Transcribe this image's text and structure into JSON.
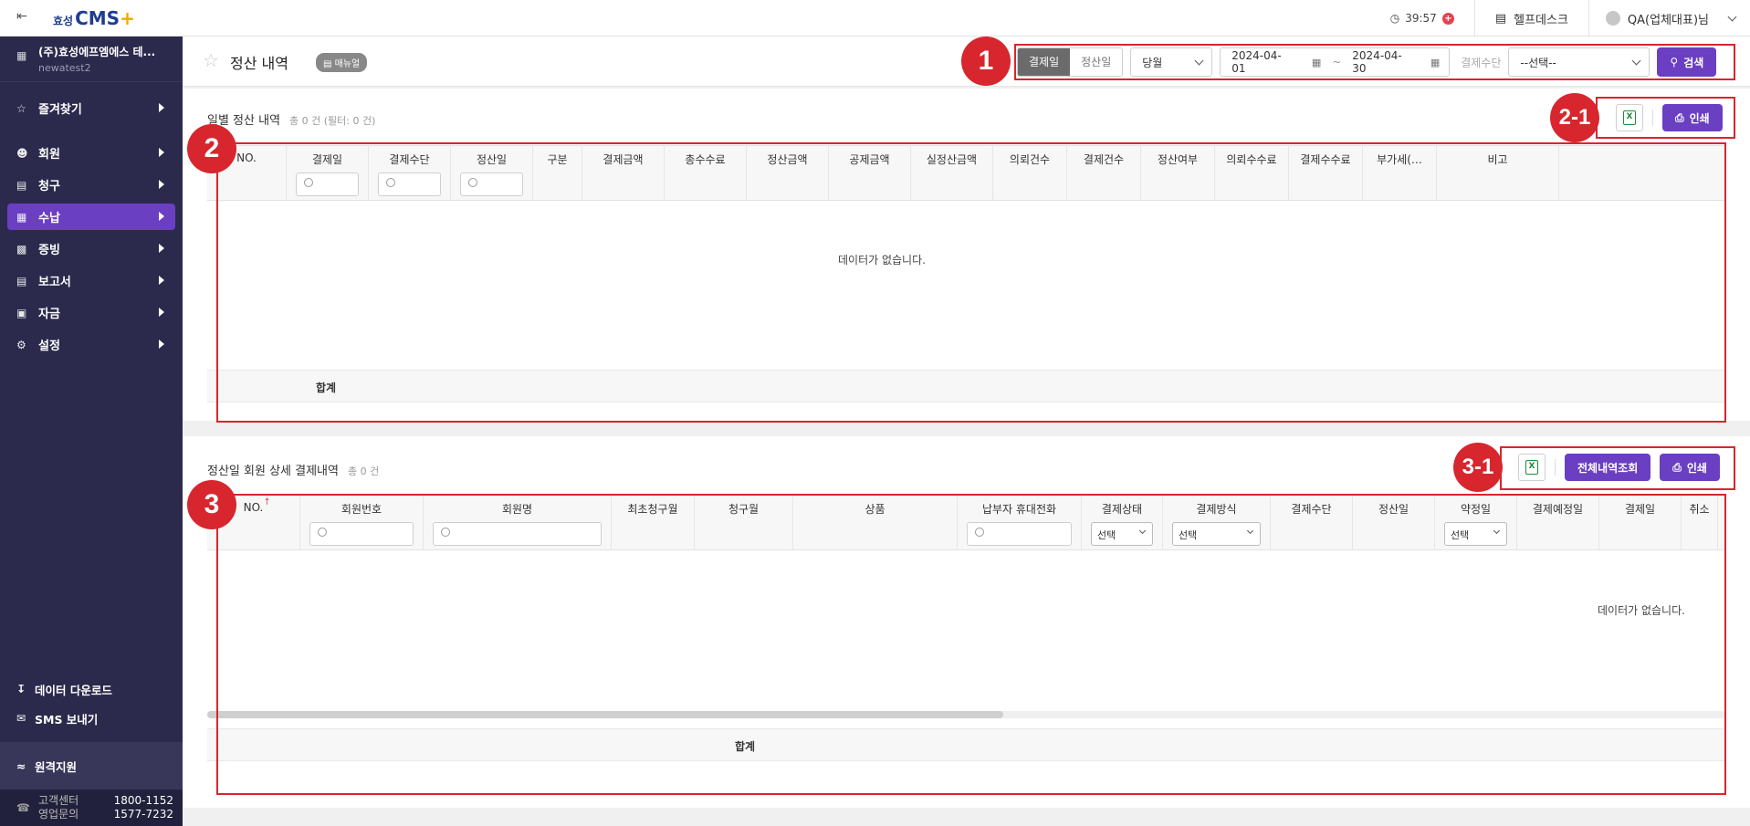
{
  "topbar": {
    "logo_prefix": "효성",
    "logo_main": "CMS",
    "logo_plus": "+",
    "timer": "39:57",
    "help": "헬프데스크",
    "user": "QA(업체대표)님"
  },
  "sidebar": {
    "company_name": "(주)효성에프엠에스 테...",
    "company_id": "newatest2",
    "items": [
      {
        "label": "즐겨찾기"
      },
      {
        "label": "회원"
      },
      {
        "label": "청구"
      },
      {
        "label": "수납"
      },
      {
        "label": "증빙"
      },
      {
        "label": "보고서"
      },
      {
        "label": "자금"
      },
      {
        "label": "설정"
      }
    ],
    "active_index": 3,
    "utilities": [
      {
        "label": "데이터 다운로드"
      },
      {
        "label": "SMS 보내기"
      }
    ],
    "remote": "원격지원",
    "contact_labels": [
      "고객센터",
      "영업문의"
    ],
    "contact_numbers": [
      "1800-1152",
      "1577-7232"
    ]
  },
  "page": {
    "title": "정산 내역",
    "manual_badge": "매뉴얼"
  },
  "filters": {
    "date_type_options": [
      "결제일",
      "정산일"
    ],
    "date_type_selected": "결제일",
    "period": "당월",
    "date_from": "2024-04-01",
    "date_separator": "~",
    "date_to": "2024-04-30",
    "method_label": "결제수단",
    "method_value": "--선택--",
    "search_label": "검색"
  },
  "section1": {
    "title": "일별 정산 내역",
    "count": "총 0 건 (필터: 0 건)",
    "print_label": "인쇄",
    "columns": [
      "NO.",
      "결제일",
      "결제수단",
      "정산일",
      "구분",
      "결제금액",
      "총수수료",
      "정산금액",
      "공제금액",
      "실정산금액",
      "의뢰건수",
      "결제건수",
      "정산여부",
      "의뢰수수료",
      "결제수수료",
      "부가세(…",
      "비고"
    ],
    "empty": "데이터가 없습니다.",
    "sum_label": "합계"
  },
  "section2": {
    "title": "정산일 회원 상세 결제내역",
    "count": "총 0 건",
    "all_label": "전체내역조회",
    "print_label": "인쇄",
    "columns": [
      "NO.",
      "회원번호",
      "회원명",
      "최초청구월",
      "청구월",
      "상품",
      "납부자 휴대전화",
      "결제상태",
      "결제방식",
      "결제수단",
      "정산일",
      "약정일",
      "결제예정일",
      "결제일",
      "취소"
    ],
    "select_placeholder": "선택",
    "empty": "데이터가 없습니다.",
    "sum_label": "합계"
  },
  "annotations": {
    "b1": "1",
    "b2": "2",
    "b21": "2-1",
    "b3": "3",
    "b31": "3-1"
  },
  "colors": {
    "sidebar_bg": "#2b2a4c",
    "accent": "#6a3fc2",
    "annotation": "#d7262e"
  }
}
